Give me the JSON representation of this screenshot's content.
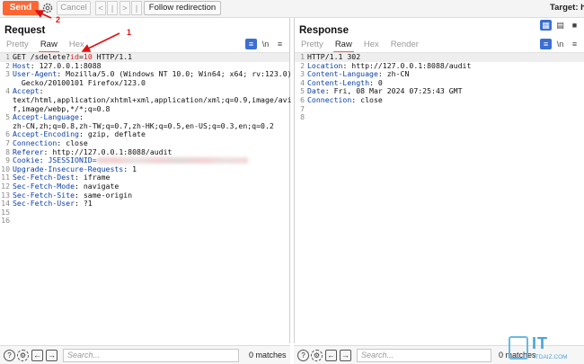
{
  "toolbar": {
    "send_label": "Send",
    "cancel_label": "Cancel",
    "back_label": "<",
    "history_back_label": "|",
    "forward_label": ">",
    "history_forward_label": "|",
    "follow_redirection_label": "Follow redirection",
    "target_label": "Target: h"
  },
  "request": {
    "title": "Request",
    "tabs": [
      "Pretty",
      "Raw",
      "Hex"
    ],
    "active_tab": "Raw",
    "lines": [
      {
        "n": "1",
        "pre": "GET /sdelete?",
        "key": "id",
        "eq": "=",
        "val": "10",
        "post": " HTTP/1.1"
      },
      {
        "n": "2",
        "k": "Host",
        "v": " 127.0.0.1:8088"
      },
      {
        "n": "3",
        "k": "User-Agent",
        "v": " Mozilla/5.0 (Windows NT 10.0; Win64; x64; rv:123.0)"
      },
      {
        "n": "",
        "k": "",
        "v": "  Gecko/20100101 Firefox/123.0"
      },
      {
        "n": "4",
        "k": "Accept",
        "v": ""
      },
      {
        "n": "",
        "k": "",
        "v": "text/html,application/xhtml+xml,application/xml;q=0.9,image/avi"
      },
      {
        "n": "",
        "k": "",
        "v": "f,image/webp,*/*;q=0.8"
      },
      {
        "n": "5",
        "k": "Accept-Language",
        "v": ""
      },
      {
        "n": "",
        "k": "",
        "v": "zh-CN,zh;q=0.8,zh-TW;q=0.7,zh-HK;q=0.5,en-US;q=0.3,en;q=0.2"
      },
      {
        "n": "6",
        "k": "Accept-Encoding",
        "v": " gzip, deflate"
      },
      {
        "n": "7",
        "k": "Connection",
        "v": " close"
      },
      {
        "n": "8",
        "k": "Referer",
        "v": " http://127.0.0.1:8088/audit"
      },
      {
        "n": "9",
        "k": "Cookie",
        "v": " JSESSIONID="
      },
      {
        "n": "10",
        "k": "Upgrade-Insecure-Requests",
        "v": " 1"
      },
      {
        "n": "11",
        "k": "Sec-Fetch-Dest",
        "v": " iframe"
      },
      {
        "n": "12",
        "k": "Sec-Fetch-Mode",
        "v": " navigate"
      },
      {
        "n": "13",
        "k": "Sec-Fetch-Site",
        "v": " same-origin"
      },
      {
        "n": "14",
        "k": "Sec-Fetch-User",
        "v": " ?1"
      },
      {
        "n": "15",
        "k": "",
        "v": ""
      },
      {
        "n": "16",
        "k": "",
        "v": ""
      }
    ],
    "search_placeholder": "Search...",
    "matches": "0 matches"
  },
  "response": {
    "title": "Response",
    "tabs": [
      "Pretty",
      "Raw",
      "Hex",
      "Render"
    ],
    "active_tab": "Raw",
    "lines": [
      {
        "n": "1",
        "k": "",
        "v": "HTTP/1.1 302"
      },
      {
        "n": "2",
        "k": "Location",
        "v": " http://127.0.0.1:8088/audit"
      },
      {
        "n": "3",
        "k": "Content-Language",
        "v": " zh-CN"
      },
      {
        "n": "4",
        "k": "Content-Length",
        "v": " 0"
      },
      {
        "n": "5",
        "k": "Date",
        "v": " Fri, 08 Mar 2024 07:25:43 GMT"
      },
      {
        "n": "6",
        "k": "Connection",
        "v": " close"
      },
      {
        "n": "7",
        "k": "",
        "v": ""
      },
      {
        "n": "8",
        "k": "",
        "v": ""
      }
    ],
    "search_placeholder": "Search...",
    "matches": "0 matches"
  },
  "annotations": {
    "arrow1": "1",
    "arrow2": "2"
  },
  "watermark": {
    "text": "IT",
    "sub": "ITDAIZ.COM"
  },
  "colors": {
    "accent": "#ff6633",
    "key": "#0b3fa8",
    "highlight": "#d12020"
  }
}
